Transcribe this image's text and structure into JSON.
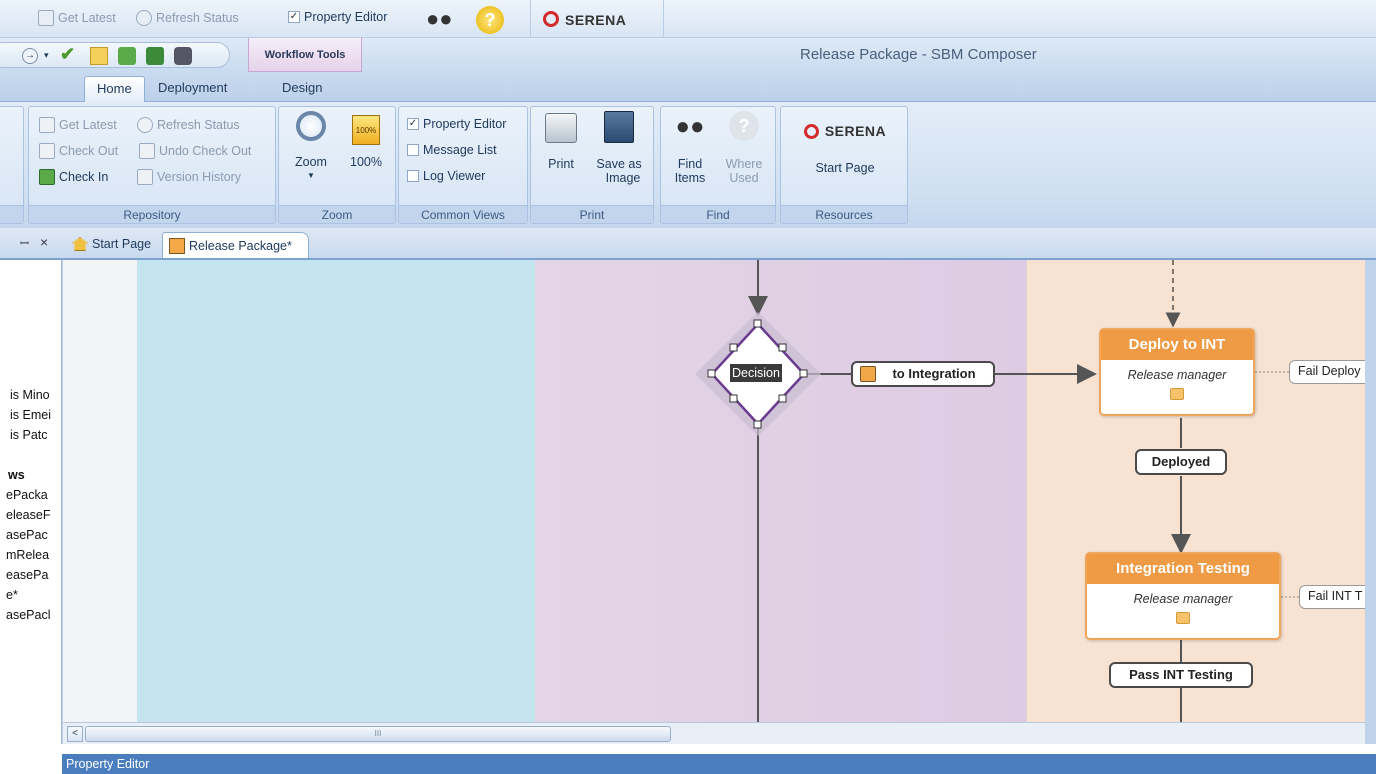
{
  "top_strip": {
    "get_latest": "Get Latest",
    "refresh_status": "Refresh Status",
    "property_editor": "Property Editor",
    "brand": "SERENA"
  },
  "qat": {
    "contextual_tab": "Workflow Tools",
    "window_title": "Release Package - SBM Composer"
  },
  "tabs": [
    {
      "label": "Home",
      "active": true
    },
    {
      "label": "Deployment",
      "active": false
    },
    {
      "label": "Design",
      "active": false
    }
  ],
  "ribbon": {
    "repository": {
      "label": "Repository",
      "get_latest": "Get Latest",
      "refresh_status": "Refresh Status",
      "check_out": "Check Out",
      "undo_check_out": "Undo Check Out",
      "check_in": "Check In",
      "version_history": "Version History"
    },
    "zoom": {
      "label": "Zoom",
      "zoom_button": "Zoom",
      "hundred": "100%",
      "hundred_icon_text": "100%"
    },
    "common_views": {
      "label": "Common Views",
      "property_editor": "Property Editor",
      "message_list": "Message List",
      "log_viewer": "Log Viewer"
    },
    "print": {
      "label": "Print",
      "print_button": "Print",
      "save_as": "Save as",
      "image": "Image"
    },
    "find": {
      "label": "Find",
      "find": "Find",
      "items": "Items",
      "where": "Where",
      "used": "Used"
    },
    "resources": {
      "label": "Resources",
      "brand": "SERENA",
      "start_page": "Start Page"
    }
  },
  "doc_tabs": [
    {
      "label": "Start Page",
      "active": false
    },
    {
      "label": "Release Package*",
      "active": true
    }
  ],
  "left_panel": {
    "pin": " p",
    "close": "×",
    "items": [
      "is Mino",
      "is Emei",
      "is Patc"
    ],
    "heading": "ws",
    "list": [
      "ePacka",
      "eleaseF",
      "asePac",
      "mRelea",
      "easePa",
      "e*",
      "asePacl"
    ]
  },
  "diagram": {
    "decision": "Decision",
    "to_integration": "to Integration",
    "deploy_state": {
      "title": "Deploy to INT",
      "role": "Release manager"
    },
    "deployed": "Deployed",
    "fail_deploy": "Fail Deploy",
    "int_testing_state": {
      "title": "Integration Testing",
      "role": "Release manager"
    },
    "fail_int": "Fail INT T",
    "pass_int": "Pass INT Testing"
  },
  "scrollbar": {
    "thumb_grip": "III"
  },
  "status_panel": {
    "label": "Property Editor"
  },
  "colors": {
    "lane_blue": "#c4e4ef",
    "lane_purple": "#e1d2e6",
    "lane_orange": "#f8e3d3",
    "state_header": "#ef9b45",
    "decision_border": "#7a4a9a"
  }
}
